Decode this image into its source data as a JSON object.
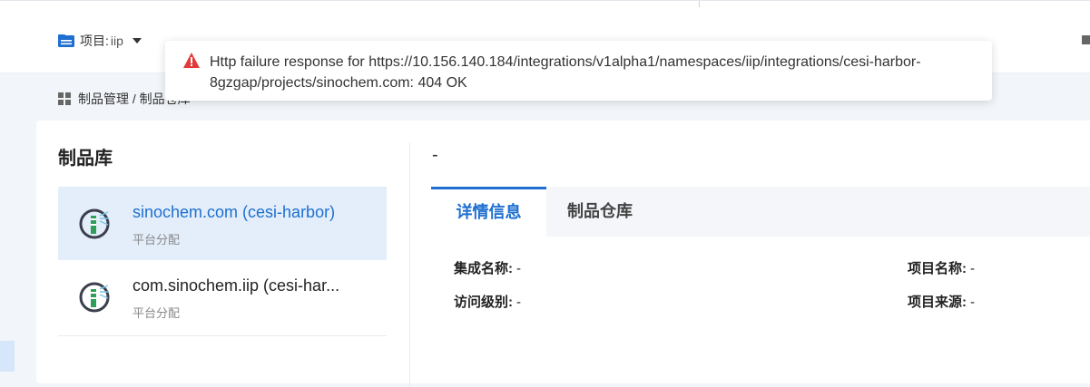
{
  "header": {
    "project_label": "项目:",
    "project_value": "iip"
  },
  "breadcrumb": {
    "text": "制品管理 / 制品仓库"
  },
  "toast": {
    "type": "error",
    "message": "Http failure response for https://10.156.140.184/integrations/v1alpha1/namespaces/iip/integrations/cesi-harbor-8gzgap/projects/sinochem.com: 404 OK"
  },
  "card": {
    "title": "制品库",
    "items": [
      {
        "name": "sinochem.com (cesi-harbor)",
        "sub": "平台分配"
      },
      {
        "name": "com.sinochem.iip (cesi-har...",
        "sub": "平台分配"
      }
    ]
  },
  "detail": {
    "title": "-",
    "tabs": [
      {
        "label": "详情信息"
      },
      {
        "label": "制品仓库"
      }
    ],
    "fields": {
      "integration_name_label": "集成名称:",
      "integration_name_value": "-",
      "project_name_label": "项目名称:",
      "project_name_value": "-",
      "access_level_label": "访问级别:",
      "access_level_value": "-",
      "project_source_label": "项目来源:",
      "project_source_value": "-"
    }
  },
  "colors": {
    "accent": "#1e6fd0",
    "error": "#e03a3a",
    "active_bg": "#e3eefa"
  },
  "icons": [
    "folder-icon",
    "caret-down-icon",
    "grid-icon",
    "warning-icon",
    "harbor-logo-icon"
  ]
}
